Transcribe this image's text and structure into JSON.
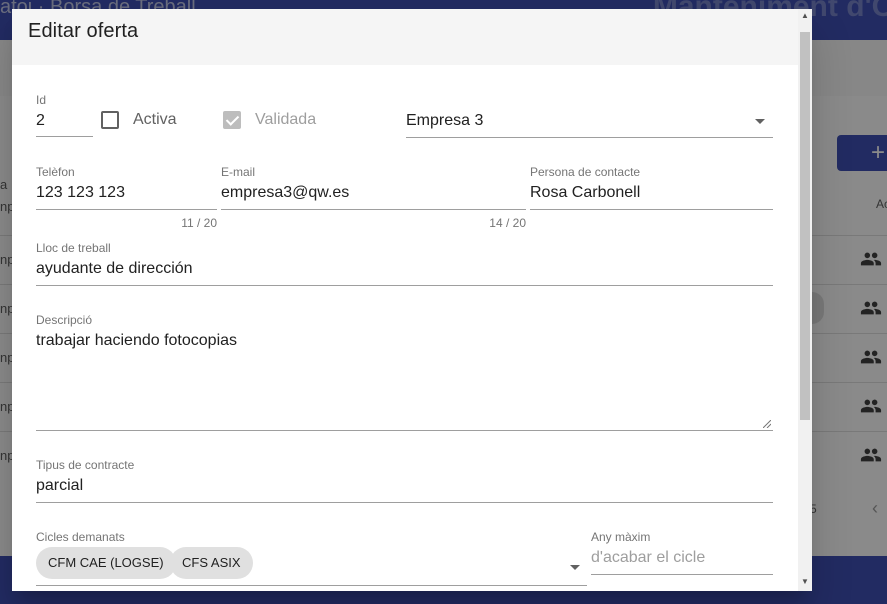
{
  "background": {
    "breadcrumb": "atoi · Borsa de Treball",
    "page_title": "Manteniment d'O",
    "add_button_icon": "plus-icon",
    "actions_header": "Ac",
    "row_prefixes": [
      "np",
      "np",
      "np",
      "np",
      "np"
    ],
    "left_header": "np",
    "left_filter": "a",
    "pager_text": "5",
    "row_icon": "group-icon"
  },
  "dialog": {
    "title": "Editar oferta",
    "id": {
      "label": "Id",
      "value": "2"
    },
    "activa": {
      "label": "Activa",
      "checked": false
    },
    "validada": {
      "label": "Validada",
      "checked": true,
      "disabled": true
    },
    "empresa": {
      "value": "Empresa 3"
    },
    "telefon": {
      "label": "Telèfon",
      "value": "123 123 123",
      "counter": "11 / 20"
    },
    "email": {
      "label": "E-mail",
      "value": "empresa3@qw.es",
      "counter": "14 / 20"
    },
    "contacte": {
      "label": "Persona de contacte",
      "value": "Rosa Carbonell"
    },
    "lloc": {
      "label": "Lloc de treball",
      "value": "ayudante de dirección"
    },
    "descripcio": {
      "label": "Descripció",
      "value": "trabajar haciendo fotocopias"
    },
    "contracte": {
      "label": "Tipus de contracte",
      "value": "parcial"
    },
    "cicles": {
      "label": "Cicles demanats",
      "chips": [
        "CFM CAE (LOGSE)",
        "CFS ASIX"
      ]
    },
    "any": {
      "label": "Any màxim",
      "placeholder": "d'acabar el cicle"
    }
  },
  "colors": {
    "primary": "#3f51b5",
    "header_bg": "#f5f5f5",
    "chip_bg": "#e0e0e0"
  }
}
